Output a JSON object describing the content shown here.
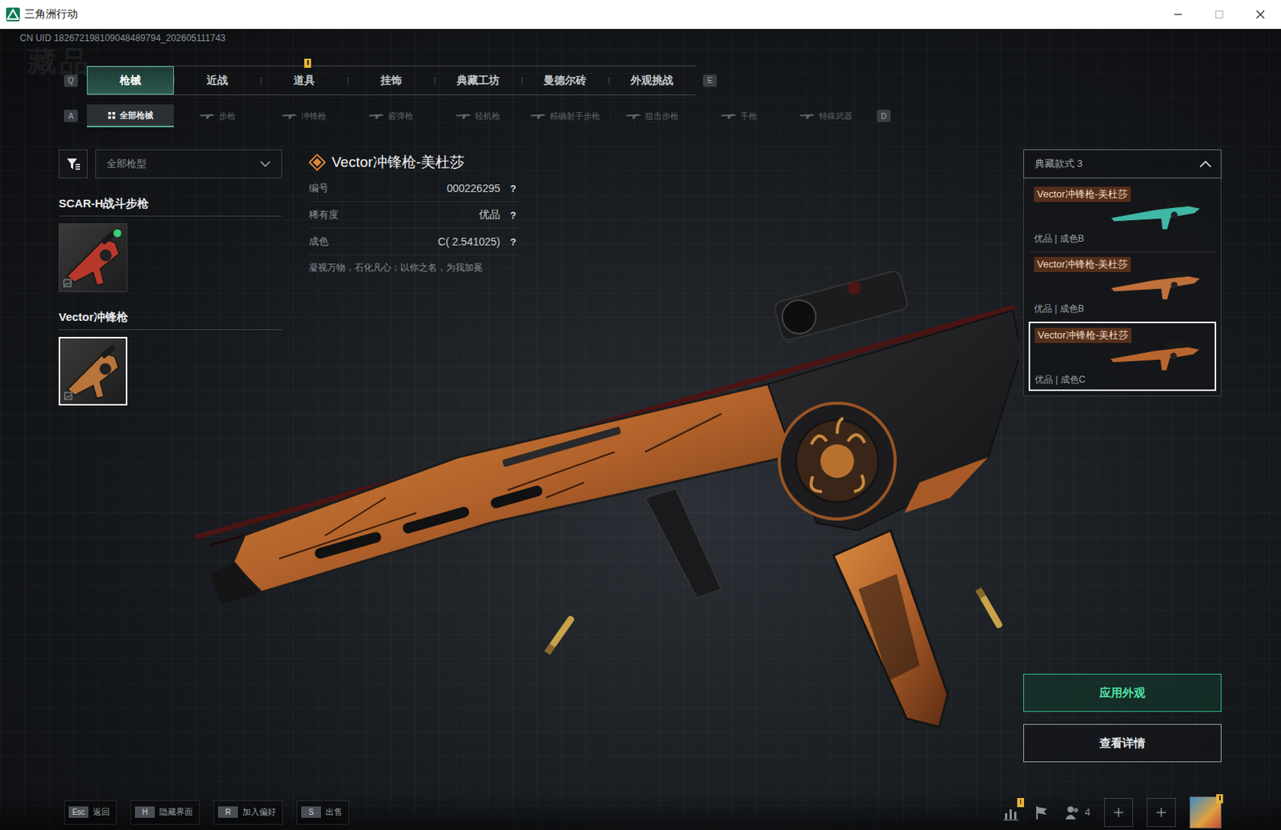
{
  "window": {
    "title": "三角洲行动",
    "uid": "CN UID 182672198109048489794_202605111743"
  },
  "watermark": "藏品",
  "main_tabs": {
    "prev_key": "Q",
    "next_key": "E",
    "items": [
      {
        "label": "枪械",
        "selected": true,
        "alert": false
      },
      {
        "label": "近战",
        "selected": false,
        "alert": false
      },
      {
        "label": "道具",
        "selected": false,
        "alert": true
      },
      {
        "label": "挂饰",
        "selected": false,
        "alert": false
      },
      {
        "label": "典藏工坊",
        "selected": false,
        "alert": false
      },
      {
        "label": "曼德尔砖",
        "selected": false,
        "alert": false
      },
      {
        "label": "外观挑战",
        "selected": false,
        "alert": false
      }
    ]
  },
  "sub_tabs": {
    "prev_key": "A",
    "next_key": "D",
    "items": [
      {
        "label": "全部枪械",
        "selected": true,
        "kind": "all"
      },
      {
        "label": "步枪",
        "selected": false,
        "kind": "weapon"
      },
      {
        "label": "冲锋枪",
        "selected": false,
        "kind": "weapon"
      },
      {
        "label": "霰弹枪",
        "selected": false,
        "kind": "weapon"
      },
      {
        "label": "轻机枪",
        "selected": false,
        "kind": "weapon"
      },
      {
        "label": "精确射手步枪",
        "selected": false,
        "kind": "weapon"
      },
      {
        "label": "狙击步枪",
        "selected": false,
        "kind": "weapon"
      },
      {
        "label": "手枪",
        "selected": false,
        "kind": "weapon"
      },
      {
        "label": "特殊武器",
        "selected": false,
        "kind": "weapon"
      }
    ]
  },
  "filter": {
    "value": "全部枪型"
  },
  "groups": [
    {
      "title": "SCAR-H战斗步枪",
      "items": [
        {
          "selected": false,
          "equipped": true,
          "color": "#b8392b"
        }
      ]
    },
    {
      "title": "Vector冲锋枪",
      "items": [
        {
          "selected": true,
          "equipped": false,
          "color": "#b8743a"
        }
      ]
    }
  ],
  "detail": {
    "name": "Vector冲锋枪-美杜莎",
    "fields": [
      {
        "label": "编号",
        "value": "000226295",
        "help": "?"
      },
      {
        "label": "稀有度",
        "value": "优品",
        "help": "?"
      },
      {
        "label": "成色",
        "value": "C( 2.541025)",
        "help": "?"
      }
    ],
    "description": "凝视万物，石化凡心；以你之名，为我加冕"
  },
  "styles": {
    "header": "典藏款式 3",
    "expanded": true,
    "items": [
      {
        "name": "Vector冲锋枪-美杜莎",
        "grade": "优品 | 成色B",
        "selected": false,
        "color": "#3fb8a6"
      },
      {
        "name": "Vector冲锋枪-美杜莎",
        "grade": "优品 | 成色B",
        "selected": false,
        "color": "#c0703a"
      },
      {
        "name": "Vector冲锋枪-美杜莎",
        "grade": "优品 | 成色C",
        "selected": true,
        "color": "#b8662e"
      }
    ]
  },
  "actions": [
    {
      "label": "应用外观",
      "primary": true
    },
    {
      "label": "查看详情",
      "primary": false
    }
  ],
  "hints": [
    {
      "key": "Esc",
      "label": "返回"
    },
    {
      "key": "H",
      "label": "隐藏界面"
    },
    {
      "key": "R",
      "label": "加入偏好"
    },
    {
      "key": "S",
      "label": "出售"
    }
  ],
  "status": {
    "stats_alert": true,
    "friends": "4",
    "avatar_alert": true
  }
}
